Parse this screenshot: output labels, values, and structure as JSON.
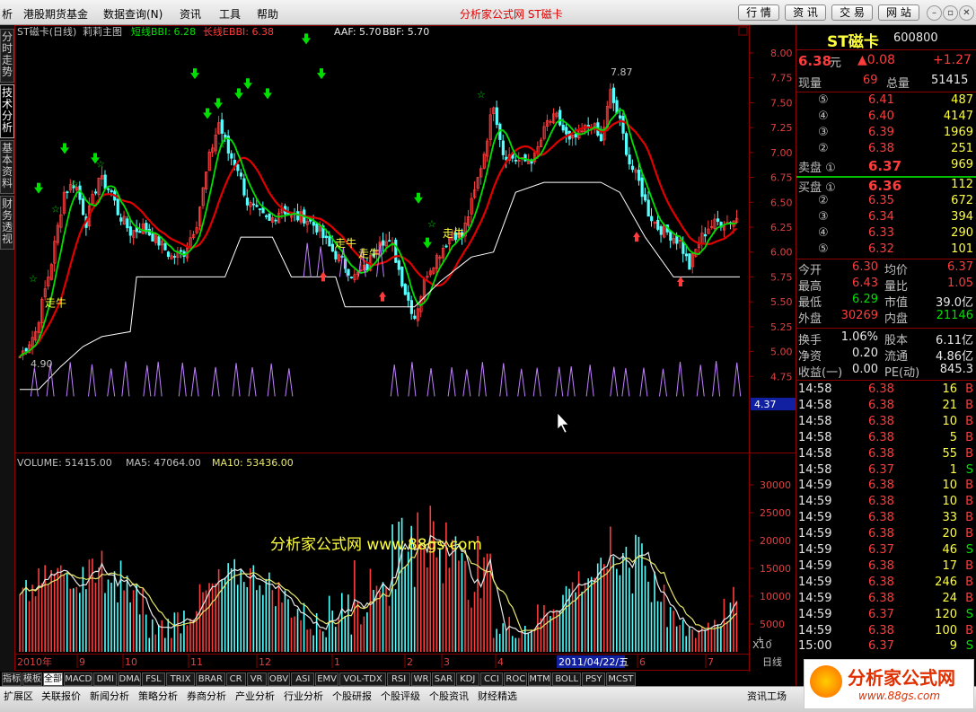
{
  "menubar": {
    "items": [
      "析",
      "港股期货基金",
      "数据查询(N)",
      "资讯",
      "工具",
      "帮助"
    ],
    "title": "分析家公式网 ST磁卡",
    "nav_buttons": [
      "行 情",
      "资 讯",
      "交 易",
      "网 站"
    ]
  },
  "side_tabs": [
    "分时走势",
    "技术分析",
    "基本资料",
    "财务透视"
  ],
  "upper_chart": {
    "header": {
      "stock": "ST磁卡(日线)",
      "indicator": "莉莉主图",
      "short_bbi": "短线BBI: 6.28",
      "long_ebbi": "长线EBBI: 6.38",
      "aaf": "AAF: 5.70",
      "bbf": "BBF: 5.70"
    },
    "price_ticks": [
      "8.00",
      "7.75",
      "7.50",
      "7.25",
      "7.00",
      "6.75",
      "6.50",
      "6.25",
      "6.00",
      "5.75",
      "5.50",
      "5.25",
      "5.00",
      "4.75",
      "4.50"
    ],
    "high_label": "7.87",
    "low_label": "4.90",
    "cursor_price": "4.37",
    "signal_text": [
      "走牛",
      "走牛",
      "走牛",
      "走牛"
    ],
    "colors": {
      "up": "#ff3c3c",
      "down": "#54ffff",
      "short": "#00e000",
      "long": "#e00000",
      "support": "#ffffff",
      "signal": "#00e000"
    }
  },
  "volume_chart": {
    "header": {
      "volume": "VOLUME: 51415.00",
      "ma5": "MA5: 47064.00",
      "ma10": "MA10: 53436.00"
    },
    "ticks": [
      "30000",
      "25000",
      "20000",
      "15000",
      "10000",
      "5000"
    ],
    "unit": "X10",
    "watermark": "分析家公式网 www.88gs.com"
  },
  "date_axis": {
    "labels": [
      "2010年",
      "9",
      "10",
      "11",
      "12",
      "1",
      "2",
      "3",
      "4",
      "5",
      "6",
      "7"
    ],
    "cursor_date": "2011/04/22/五",
    "period": "日线"
  },
  "indicator_tabs": [
    "指标",
    "模板",
    "全部",
    "MACD",
    "DMI",
    "DMA",
    "FSL",
    "TRIX",
    "BRAR",
    "CR",
    "VR",
    "OBV",
    "ASI",
    "EMV",
    "VOL-TDX",
    "RSI",
    "WR",
    "SAR",
    "KDJ",
    "CCI",
    "ROC",
    "MTM",
    "BOLL",
    "PSY",
    "MCST"
  ],
  "bottom_bar": [
    "扩展区",
    "关联报价",
    "新闻分析",
    "策略分析",
    "券商分析",
    "产业分析",
    "行业分析",
    "个股研报",
    "个股评级",
    "个股资讯",
    "财经精选",
    "资讯工场"
  ],
  "quote_panel": {
    "name": "ST磁卡",
    "code": "600800",
    "price": "6.38",
    "price_unit": "元",
    "change": "▲0.08",
    "change_pct": "+1.27",
    "cur_vol_label": "现量",
    "cur_vol": "69",
    "total_vol_label": "总量",
    "total_vol": "51415",
    "sell": [
      {
        "lvl": "⑤",
        "price": "6.41",
        "vol": "487"
      },
      {
        "lvl": "④",
        "price": "6.40",
        "vol": "4147"
      },
      {
        "lvl": "③",
        "price": "6.39",
        "vol": "1969"
      },
      {
        "lvl": "②",
        "price": "6.38",
        "vol": "251"
      },
      {
        "lvl": "卖盘 ①",
        "price": "6.37",
        "vol": "969"
      }
    ],
    "buy": [
      {
        "lvl": "买盘 ①",
        "price": "6.36",
        "vol": "112"
      },
      {
        "lvl": "②",
        "price": "6.35",
        "vol": "672"
      },
      {
        "lvl": "③",
        "price": "6.34",
        "vol": "394"
      },
      {
        "lvl": "④",
        "price": "6.33",
        "vol": "290"
      },
      {
        "lvl": "⑤",
        "price": "6.32",
        "vol": "101"
      }
    ],
    "stats": [
      {
        "l1": "今开",
        "v1": "6.30",
        "l2": "均价",
        "v2": "6.37"
      },
      {
        "l1": "最高",
        "v1": "6.43",
        "l2": "量比",
        "v2": "1.05"
      },
      {
        "l1": "最低",
        "v1": "6.29",
        "l2": "市值",
        "v2": "39.0亿"
      },
      {
        "l1": "外盘",
        "v1": "30269",
        "l2": "内盘",
        "v2": "21146"
      }
    ],
    "stats2": [
      {
        "l1": "换手",
        "v1": "1.06%",
        "l2": "股本",
        "v2": "6.11亿"
      },
      {
        "l1": "净资",
        "v1": "0.20",
        "l2": "流通",
        "v2": "4.86亿"
      },
      {
        "l1": "收益(一)",
        "v1": "0.00",
        "l2": "PE(动)",
        "v2": "845.3"
      }
    ],
    "ticks": [
      {
        "t": "14:58",
        "p": "6.38",
        "v": "16",
        "s": "B"
      },
      {
        "t": "14:58",
        "p": "6.38",
        "v": "21",
        "s": "B"
      },
      {
        "t": "14:58",
        "p": "6.38",
        "v": "10",
        "s": "B"
      },
      {
        "t": "14:58",
        "p": "6.38",
        "v": "5",
        "s": "B"
      },
      {
        "t": "14:58",
        "p": "6.38",
        "v": "55",
        "s": "B"
      },
      {
        "t": "14:58",
        "p": "6.37",
        "v": "1",
        "s": "S"
      },
      {
        "t": "14:59",
        "p": "6.38",
        "v": "10",
        "s": "B"
      },
      {
        "t": "14:59",
        "p": "6.38",
        "v": "10",
        "s": "B"
      },
      {
        "t": "14:59",
        "p": "6.38",
        "v": "33",
        "s": "B"
      },
      {
        "t": "14:59",
        "p": "6.38",
        "v": "20",
        "s": "B"
      },
      {
        "t": "14:59",
        "p": "6.37",
        "v": "46",
        "s": "S"
      },
      {
        "t": "14:59",
        "p": "6.38",
        "v": "17",
        "s": "B"
      },
      {
        "t": "14:59",
        "p": "6.38",
        "v": "246",
        "s": "B"
      },
      {
        "t": "14:59",
        "p": "6.38",
        "v": "24",
        "s": "B"
      },
      {
        "t": "14:59",
        "p": "6.37",
        "v": "120",
        "s": "S"
      },
      {
        "t": "14:59",
        "p": "6.38",
        "v": "100",
        "s": "B"
      },
      {
        "t": "15:00",
        "p": "6.37",
        "v": "9",
        "s": "S"
      }
    ]
  },
  "logo": {
    "text": "分析家公式网",
    "url": "www.88gs.com"
  }
}
